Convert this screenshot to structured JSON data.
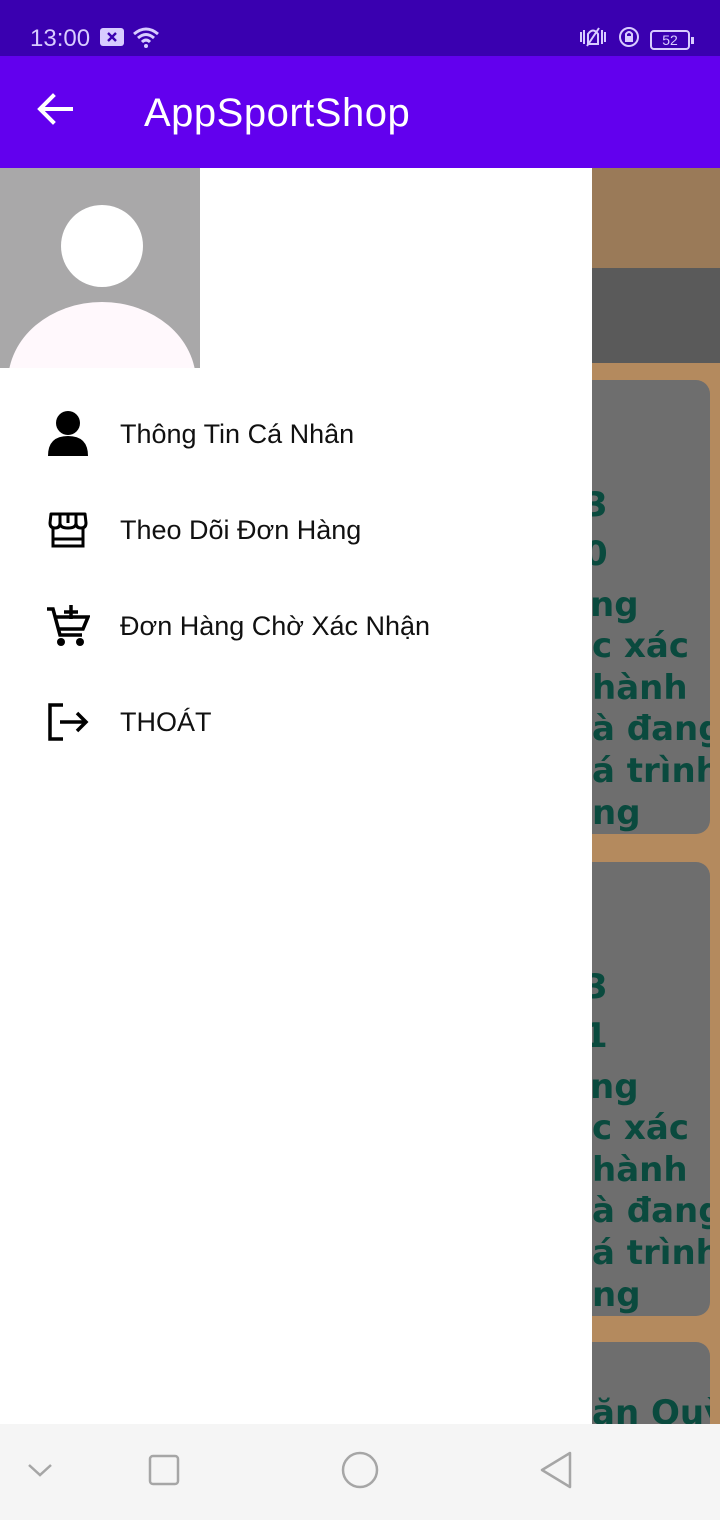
{
  "status_bar": {
    "time": "13:00",
    "battery": "52",
    "icons": [
      "x-notification-icon",
      "wifi-icon",
      "vibrate-icon",
      "lock-rotation-icon",
      "battery-icon"
    ]
  },
  "app_bar": {
    "title": "AppSportShop",
    "back_icon": "arrow-left-icon",
    "background": "#6200ee"
  },
  "drawer": {
    "avatar_icon": "default-avatar",
    "menu": [
      {
        "label": "Thông Tin Cá Nhân",
        "icon": "person-icon"
      },
      {
        "label": "Theo Dõi Đơn Hàng",
        "icon": "store-icon"
      },
      {
        "label": "Đơn Hàng Chờ Xác Nhận",
        "icon": "cart-plus-icon"
      },
      {
        "label": "THOÁT",
        "icon": "logout-icon"
      }
    ]
  },
  "background_cards": [
    {
      "lines": [
        "3",
        "0",
        "ng",
        "c xác",
        "hành",
        "à đang",
        "á trình",
        "ng"
      ]
    },
    {
      "lines": [
        "3",
        "1",
        "ng",
        "c xác",
        "hành",
        "à đang",
        "á trình",
        "ng"
      ]
    },
    {
      "lines": [
        "ăn Quỳ"
      ]
    }
  ],
  "nav_bar": {
    "buttons": [
      "chevron-down-icon",
      "recents-square-icon",
      "home-circle-icon",
      "back-triangle-icon"
    ]
  }
}
